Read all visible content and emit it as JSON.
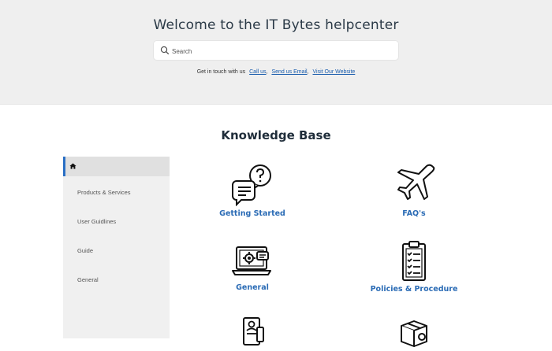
{
  "hero": {
    "title": "Welcome to the IT Bytes helpcenter",
    "search_placeholder": "Search",
    "contact_text": "Get in touch with us",
    "contact_links": [
      "Call us",
      "Send us Email",
      "Visit Our Website"
    ]
  },
  "kb": {
    "title": "Knowledge Base"
  },
  "sidebar": {
    "items": [
      "Products & Services",
      "User Guidlines",
      "Guide",
      "General"
    ]
  },
  "cards": [
    {
      "label": "Getting Started",
      "icon": "chat-question-icon"
    },
    {
      "label": "FAQ's",
      "icon": "airplane-icon"
    },
    {
      "label": "General",
      "icon": "laptop-settings-icon"
    },
    {
      "label": "Policies & Procedure",
      "icon": "clipboard-checklist-icon"
    },
    {
      "label": "",
      "icon": "document-certificate-icon"
    },
    {
      "label": "",
      "icon": "box-icon"
    }
  ],
  "colors": {
    "accent": "#2a6bb5",
    "hero_bg": "#efefef",
    "sidebar_bg": "#f0f0f0",
    "link": "#1a5dad"
  }
}
